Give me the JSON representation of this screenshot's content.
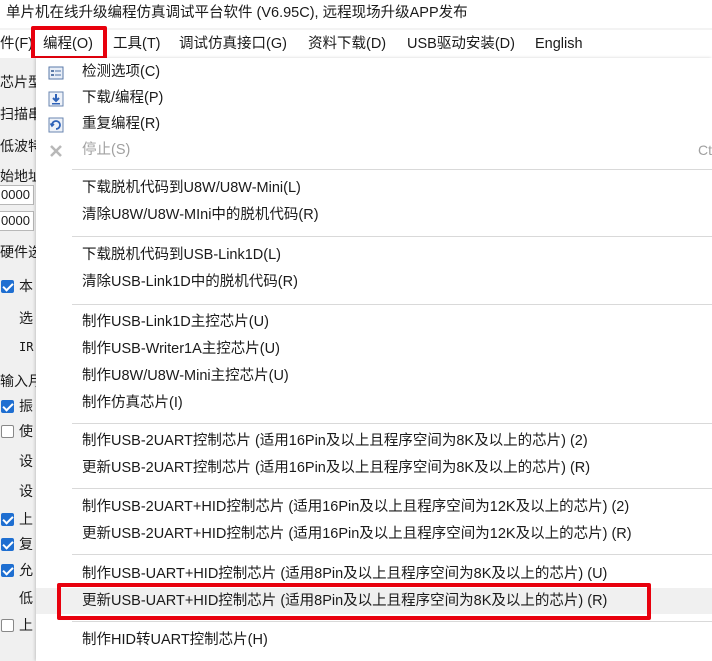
{
  "window": {
    "title": "单片机在线升级编程仿真调试平台软件 (V6.95C), 远程现场升级APP发布"
  },
  "menubar": {
    "items": [
      {
        "label": "件(F)"
      },
      {
        "label": "编程(O)"
      },
      {
        "label": "工具(T)"
      },
      {
        "label": "调试仿真接口(G)"
      },
      {
        "label": "资料下载(D)"
      },
      {
        "label": "USB驱动安装(D)"
      },
      {
        "label": "English"
      }
    ]
  },
  "left_panel": {
    "labels": [
      "芯片型",
      "扫描串",
      "低波特",
      "始地址",
      "0000",
      "0000",
      "硬件选",
      "本",
      "选",
      "IR",
      "输入月",
      "振",
      "使",
      "设",
      "设",
      "上",
      "复",
      "允",
      "低",
      "上"
    ]
  },
  "dropdown": {
    "items": [
      {
        "label": "检测选项(C)"
      },
      {
        "label": "下载/编程(P)"
      },
      {
        "label": "重复编程(R)"
      },
      {
        "label": "停止(S)",
        "shortcut_fragment": "Ct"
      },
      {
        "label": "下载脱机代码到U8W/U8W-Mini(L)"
      },
      {
        "label": "清除U8W/U8W-MIni中的脱机代码(R)"
      },
      {
        "label": "下载脱机代码到USB-Link1D(L)"
      },
      {
        "label": "清除USB-Link1D中的脱机代码(R)"
      },
      {
        "label": "制作USB-Link1D主控芯片(U)"
      },
      {
        "label": "制作USB-Writer1A主控芯片(U)"
      },
      {
        "label": "制作U8W/U8W-Mini主控芯片(U)"
      },
      {
        "label": "制作仿真芯片(I)"
      },
      {
        "label": "制作USB-2UART控制芯片 (适用16Pin及以上且程序空间为8K及以上的芯片) (2)"
      },
      {
        "label": "更新USB-2UART控制芯片 (适用16Pin及以上且程序空间为8K及以上的芯片) (R)"
      },
      {
        "label": "制作USB-2UART+HID控制芯片 (适用16Pin及以上且程序空间为12K及以上的芯片) (2)"
      },
      {
        "label": "更新USB-2UART+HID控制芯片 (适用16Pin及以上且程序空间为12K及以上的芯片) (R)"
      },
      {
        "label": "制作USB-UART+HID控制芯片 (适用8Pin及以上且程序空间为8K及以上的芯片) (U)"
      },
      {
        "label": "更新USB-UART+HID控制芯片 (适用8Pin及以上且程序空间为8K及以上的芯片) (R)"
      },
      {
        "label": "制作HID转UART控制芯片(H)"
      }
    ]
  },
  "colors": {
    "highlight": "#e8000d",
    "check_accent": "#1f6fd1",
    "disabled_text": "#a0a0a0"
  }
}
